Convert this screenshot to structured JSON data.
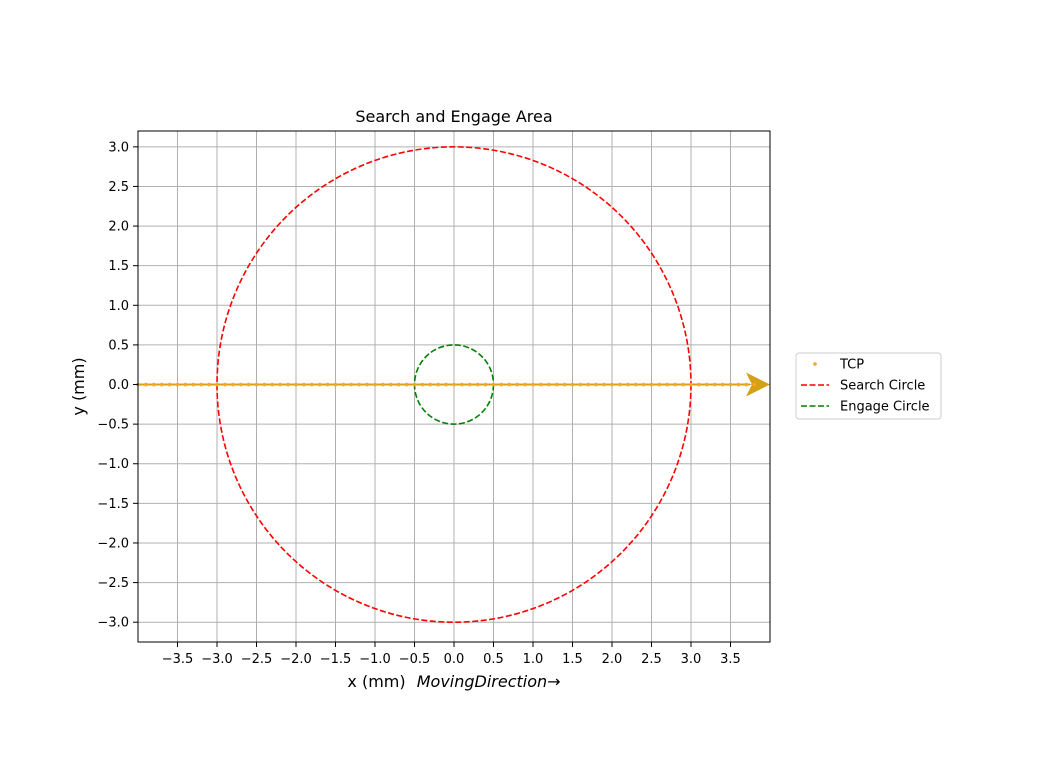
{
  "chart_data": {
    "type": "scatter",
    "title": "Search and Engage Area",
    "xlabel": "x (mm)",
    "xlabel_suffix": "MovingDirection→",
    "ylabel": "y (mm)",
    "xlim": [
      -4.0,
      4.0
    ],
    "ylim": [
      -3.25,
      3.2
    ],
    "xticks": [
      -3.5,
      -3.0,
      -2.5,
      -2.0,
      -1.5,
      -1.0,
      -0.5,
      0.0,
      0.5,
      1.0,
      1.5,
      2.0,
      2.5,
      3.0,
      3.5
    ],
    "yticks": [
      -3.0,
      -2.5,
      -2.0,
      -1.5,
      -1.0,
      -0.5,
      0.0,
      0.5,
      1.0,
      1.5,
      2.0,
      2.5,
      3.0
    ],
    "grid": true,
    "legend_placement": "outside-right",
    "series": [
      {
        "name": "TCP",
        "kind": "points",
        "color": "#f5a623",
        "x_start": -4.0,
        "x_end": 3.8,
        "x_step": 0.1,
        "y": 0.0
      },
      {
        "name": "Search Circle",
        "kind": "circle",
        "color": "#ff0000",
        "center": [
          0.0,
          0.0
        ],
        "radius": 3.0,
        "linestyle": "dashed"
      },
      {
        "name": "Engage Circle",
        "kind": "circle",
        "color": "#008000",
        "center": [
          0.0,
          0.0
        ],
        "radius": 0.5,
        "linestyle": "dashed"
      }
    ],
    "annotations": [
      {
        "kind": "arrow",
        "color": "#d4a017",
        "from": [
          -4.0,
          0.0
        ],
        "to": [
          4.0,
          0.0
        ]
      }
    ]
  }
}
